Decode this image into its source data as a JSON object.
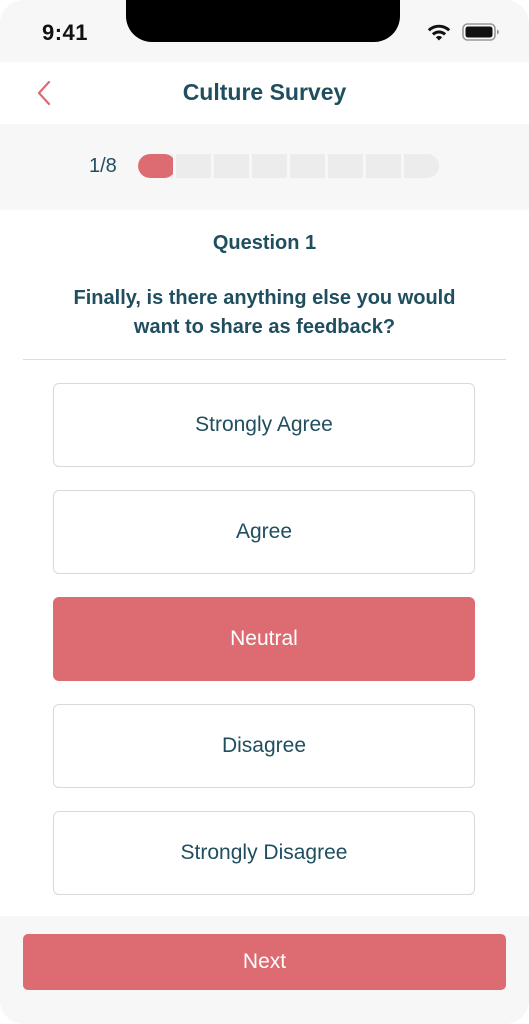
{
  "status_bar": {
    "time": "9:41",
    "icons": [
      "wifi-icon",
      "battery-icon"
    ]
  },
  "header": {
    "title": "Culture Survey",
    "back_icon": "chevron-left-icon"
  },
  "progress": {
    "label": "1/8",
    "current": 1,
    "total": 8
  },
  "question": {
    "number_label": "Question 1",
    "text": "Finally, is there anything else you would want to share as feedback?"
  },
  "options": [
    {
      "label": "Strongly Agree",
      "selected": false
    },
    {
      "label": "Agree",
      "selected": false
    },
    {
      "label": "Neutral",
      "selected": true
    },
    {
      "label": "Disagree",
      "selected": false
    },
    {
      "label": "Strongly Disagree",
      "selected": false
    }
  ],
  "footer": {
    "next_label": "Next"
  },
  "colors": {
    "accent": "#dc6b72",
    "text": "#1f4e5f",
    "background": "#f7f7f7"
  }
}
